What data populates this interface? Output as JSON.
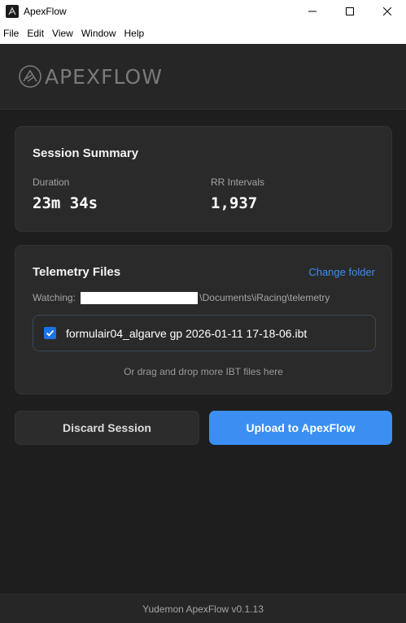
{
  "window": {
    "title": "ApexFlow",
    "minimize_glyph": "—",
    "maximize_glyph": "☐",
    "close_glyph": "✕"
  },
  "menu": [
    "File",
    "Edit",
    "View",
    "Window",
    "Help"
  ],
  "header": {
    "logo_text": "APEXFLOW",
    "logo_icon": "apexflow-logo-icon"
  },
  "summary": {
    "title": "Session Summary",
    "duration_label": "Duration",
    "duration_value": "23m 34s",
    "rr_label": "RR Intervals",
    "rr_value": "1,937"
  },
  "telemetry": {
    "title": "Telemetry Files",
    "change_folder": "Change folder",
    "watching_label": "Watching:",
    "watching_path_suffix": "\\Documents\\iRacing\\telemetry",
    "file": {
      "name": "formulair04_algarve gp 2026-01-11 17-18-06.ibt",
      "checked": true
    },
    "drop_hint": "Or drag and drop more IBT files here"
  },
  "actions": {
    "discard": "Discard Session",
    "upload": "Upload to ApexFlow"
  },
  "footer": {
    "version": "Yudemon ApexFlow v0.1.13"
  },
  "colors": {
    "accent": "#3b8ff3",
    "background": "#1e1e1e",
    "card": "#2a2a2a"
  }
}
